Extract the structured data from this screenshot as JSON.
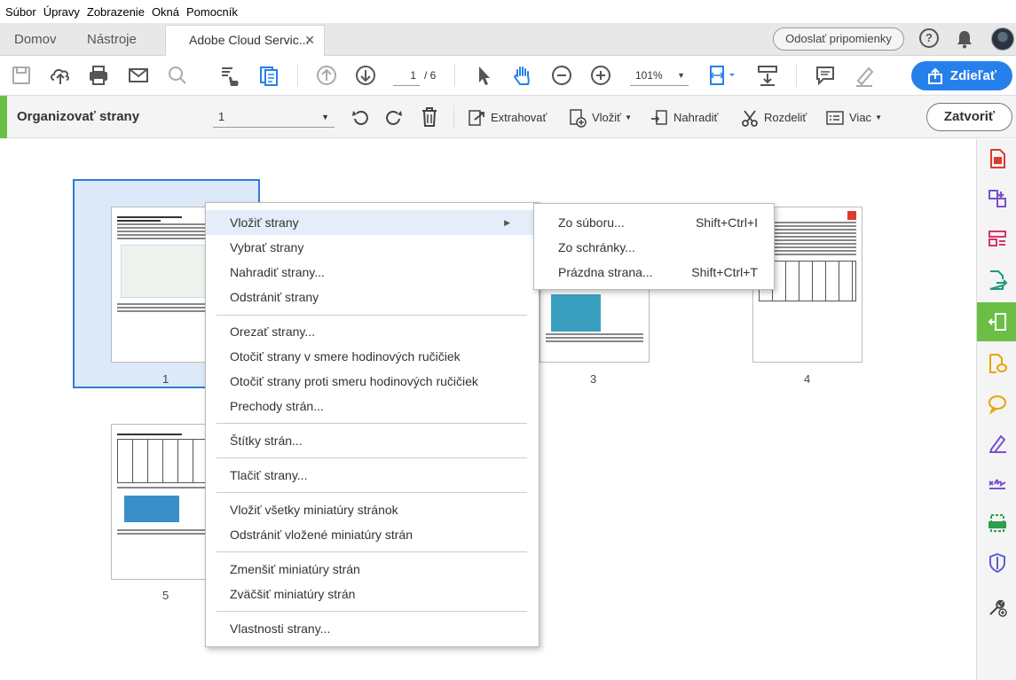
{
  "menubar": [
    "Súbor",
    "Úpravy",
    "Zobrazenie",
    "Okná",
    "Pomocník"
  ],
  "tabs": {
    "home": "Domov",
    "tools": "Nástroje",
    "document": "Adobe Cloud Servic..."
  },
  "header": {
    "feedback": "Odoslať pripomienky"
  },
  "toolbar": {
    "page_current": "1",
    "page_total": "/ 6",
    "zoom": "101%",
    "share": "Zdieľať"
  },
  "organize": {
    "title": "Organizovať strany",
    "page_select": "1",
    "extract": "Extrahovať",
    "insert": "Vložiť",
    "replace": "Nahradiť",
    "split": "Rozdeliť",
    "more": "Viac",
    "close": "Zatvoriť"
  },
  "pages": [
    "1",
    "3",
    "4",
    "5"
  ],
  "context_menu": [
    "Vložiť strany",
    "Vybrať strany",
    "Nahradiť strany...",
    "Odstrániť strany",
    "Orezať strany...",
    "Otočiť strany v smere hodinových ručičiek",
    "Otočiť strany proti smeru hodinových ručičiek",
    "Prechody strán...",
    "Štítky strán...",
    "Tlačiť strany...",
    "Vložiť všetky miniatúry stránok",
    "Odstrániť vložené miniatúry strán",
    "Zmenšiť miniatúry strán",
    "Zväčšiť miniatúry strán",
    "Vlastnosti strany..."
  ],
  "submenu": [
    {
      "label": "Zo súboru...",
      "shortcut": "Shift+Ctrl+I"
    },
    {
      "label": "Zo schránky...",
      "shortcut": ""
    },
    {
      "label": "Prázdna strana...",
      "shortcut": "Shift+Ctrl+T"
    }
  ],
  "colors": {
    "accent_green": "#6bbf44",
    "share_blue": "#2680eb",
    "selection_blue": "#2f7bd6"
  }
}
